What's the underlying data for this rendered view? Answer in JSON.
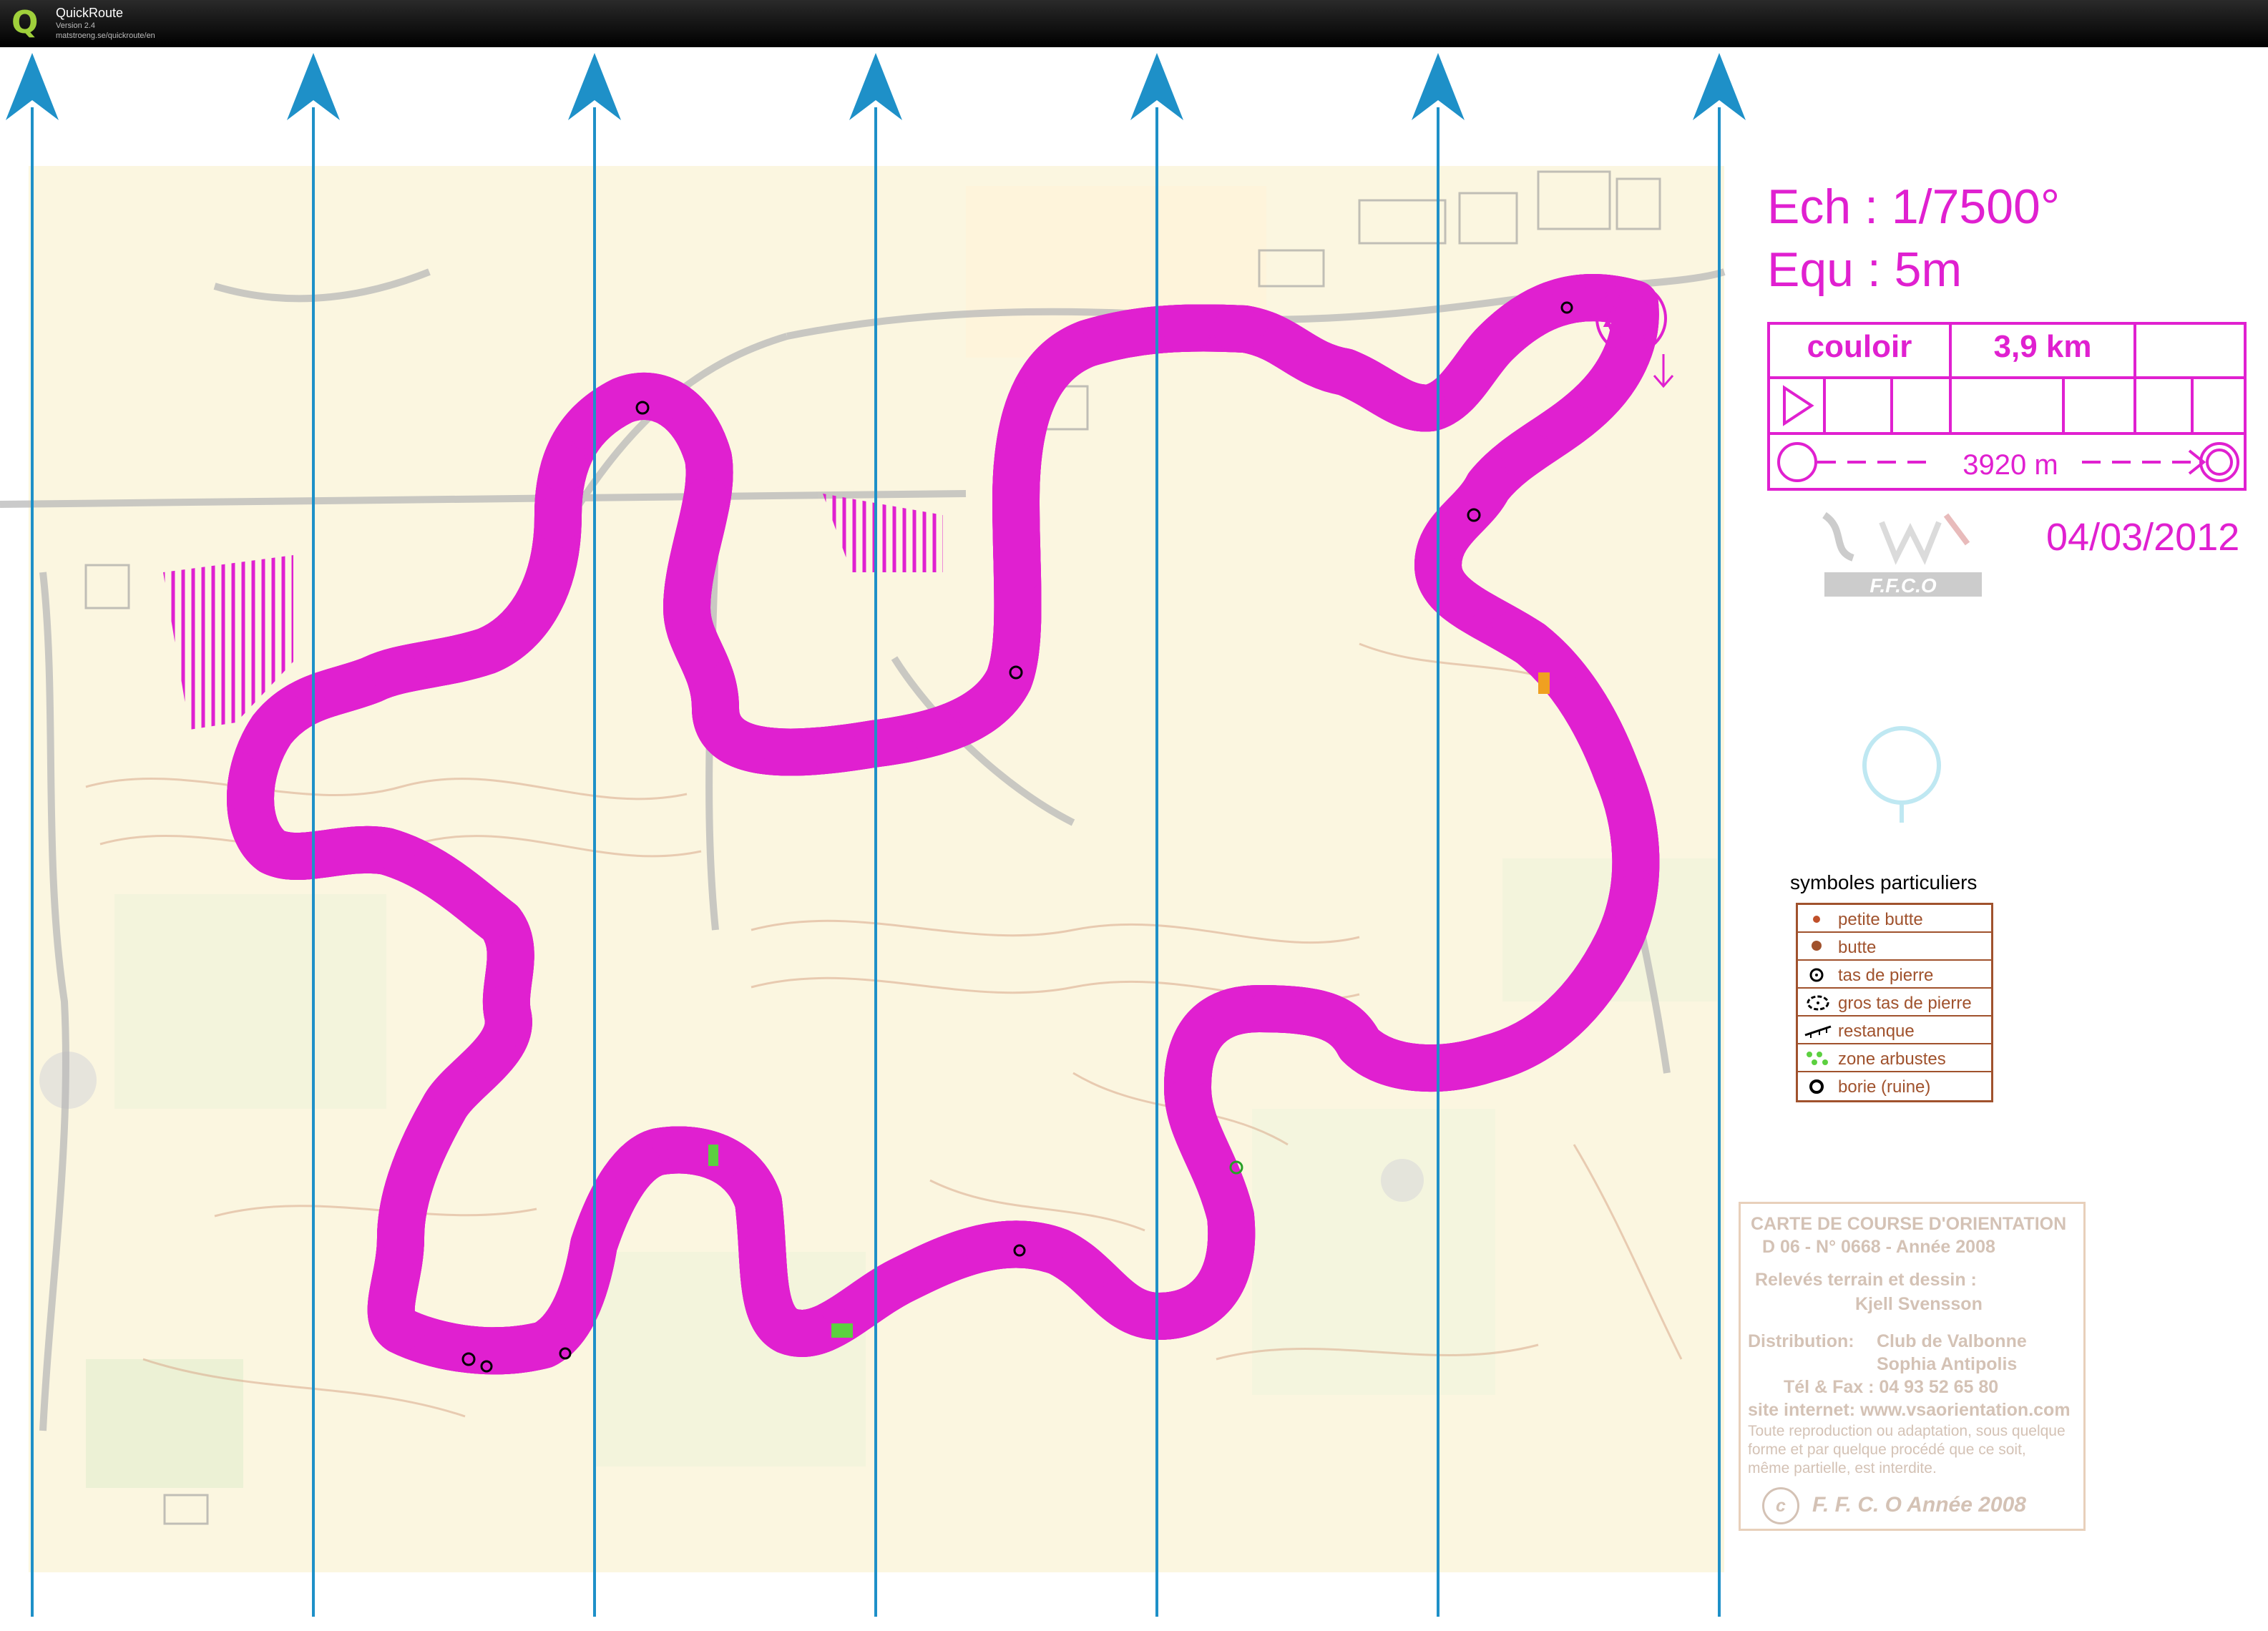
{
  "app": {
    "name": "QuickRoute",
    "version": "Version 2.4",
    "url": "matstroeng.se/quickroute/en"
  },
  "map": {
    "scale": "Ech : 1/7500°",
    "equidistance": "Equ : 5m",
    "course": {
      "name": "couloir",
      "length": "3,9 km",
      "distance": "3920 m"
    },
    "date": "04/03/2012",
    "logo_text": "F.F.C.O",
    "legend": {
      "title": "symboles particuliers",
      "items": [
        {
          "label": "petite butte",
          "symbol": "small-knoll-icon"
        },
        {
          "label": "butte",
          "symbol": "knoll-icon"
        },
        {
          "label": "tas de pierre",
          "symbol": "stone-pile-icon"
        },
        {
          "label": "gros tas de pierre",
          "symbol": "large-stone-pile-icon"
        },
        {
          "label": "restanque",
          "symbol": "terrace-wall-icon"
        },
        {
          "label": "zone arbustes",
          "symbol": "shrub-zone-icon"
        },
        {
          "label": "borie (ruine)",
          "symbol": "ruin-icon"
        }
      ]
    },
    "credits": {
      "title": "CARTE DE COURSE D'ORIENTATION",
      "reference": "D 06 - N° 0668 - Année 2008",
      "survey_label": "Relevés terrain  et dessin :",
      "surveyor": "Kjell Svensson",
      "distribution_label": "Distribution:",
      "distributor_1": "Club de Valbonne",
      "distributor_2": "Sophia Antipolis",
      "phone": "Tél & Fax : 04 93 52 65 80",
      "website": "site internet: www.vsaorientation.com",
      "notice_1": "Toute reproduction ou adaptation, sous quelque",
      "notice_2": "forme et par quelque procédé  que ce soit,",
      "notice_3": " même partielle, est interdite.",
      "copyright_symbol": "c",
      "copyright": "F. F. C. O Année 2008"
    },
    "colors": {
      "course": "#e020d0",
      "north_lines": "#1e90c8",
      "terrain": "#fbf6e0",
      "corridor": "#fcd9a6",
      "features": "#a0522d"
    }
  }
}
